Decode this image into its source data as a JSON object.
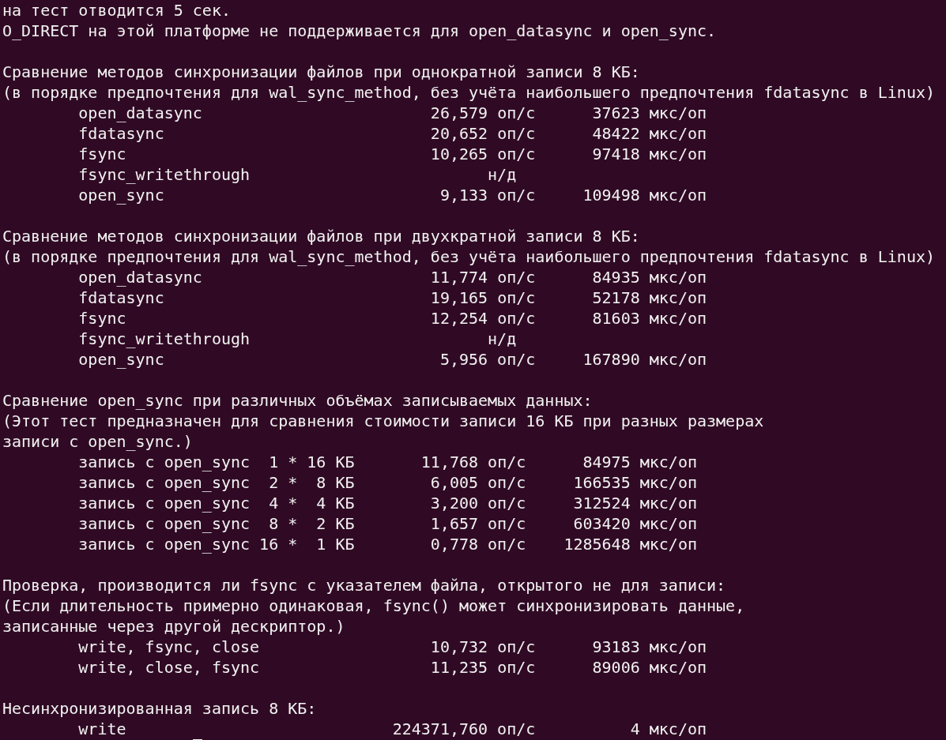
{
  "header_lines": [
    "на тест отводится 5 сек.",
    "O_DIRECT на этой платформе не поддерживается для open_datasync и open_sync."
  ],
  "sections": [
    {
      "kind": "sync",
      "title": "Сравнение методов синхронизации файлов при однократной записи 8 КБ:",
      "note_lines": [
        "(в порядке предпочтения для wal_sync_method, без учёта наибольшего предпочтения fdatasync в Linux)"
      ],
      "rows": [
        {
          "kind": "value",
          "name": "open_datasync",
          "rate": "26,579 оп/с",
          "latency": "37623 мкс/оп"
        },
        {
          "kind": "value",
          "name": "fdatasync",
          "rate": "20,652 оп/с",
          "latency": "48422 мкс/оп"
        },
        {
          "kind": "value",
          "name": "fsync",
          "rate": "10,265 оп/с",
          "latency": "97418 мкс/оп"
        },
        {
          "kind": "na",
          "name": "fsync_writethrough",
          "rate": "н/д"
        },
        {
          "kind": "value",
          "name": "open_sync",
          "rate": "9,133 оп/с",
          "latency": "109498 мкс/оп"
        }
      ]
    },
    {
      "kind": "sync",
      "title": "Сравнение методов синхронизации файлов при двухкратной записи 8 КБ:",
      "note_lines": [
        "(в порядке предпочтения для wal_sync_method, без учёта наибольшего предпочтения fdatasync в Linux)"
      ],
      "rows": [
        {
          "kind": "value",
          "name": "open_datasync",
          "rate": "11,774 оп/с",
          "latency": "84935 мкс/оп"
        },
        {
          "kind": "value",
          "name": "fdatasync",
          "rate": "19,165 оп/с",
          "latency": "52178 мкс/оп"
        },
        {
          "kind": "value",
          "name": "fsync",
          "rate": "12,254 оп/с",
          "latency": "81603 мкс/оп"
        },
        {
          "kind": "na",
          "name": "fsync_writethrough",
          "rate": "н/д"
        },
        {
          "kind": "value",
          "name": "open_sync",
          "rate": "5,956 оп/с",
          "latency": "167890 мкс/оп"
        }
      ]
    },
    {
      "kind": "size",
      "title": "Сравнение open_sync при различных объёмах записываемых данных:",
      "note_lines": [
        "(Этот тест предназначен для сравнения стоимости записи 16 КБ при разных размерах",
        "записи с open_sync.)"
      ],
      "rows": [
        {
          "kind": "value",
          "name": "запись с open_sync  1 * 16 КБ",
          "rate": "11,768 оп/с",
          "latency": "84975 мкс/оп"
        },
        {
          "kind": "value",
          "name": "запись с open_sync  2 *  8 КБ",
          "rate": "6,005 оп/с",
          "latency": "166535 мкс/оп"
        },
        {
          "kind": "value",
          "name": "запись с open_sync  4 *  4 КБ",
          "rate": "3,200 оп/с",
          "latency": "312524 мкс/оп"
        },
        {
          "kind": "value",
          "name": "запись с open_sync  8 *  2 КБ",
          "rate": "1,657 оп/с",
          "latency": "603420 мкс/оп"
        },
        {
          "kind": "value",
          "name": "запись с open_sync 16 *  1 КБ",
          "rate": "0,778 оп/с",
          "latency": "1285648 мкс/оп"
        }
      ]
    },
    {
      "kind": "sync",
      "title": "Проверка, производится ли fsync с указателем файла, открытого не для записи:",
      "note_lines": [
        "(Если длительность примерно одинаковая, fsync() может синхронизировать данные,",
        "записанные через другой дескриптор.)"
      ],
      "rows": [
        {
          "kind": "value",
          "name": "write, fsync, close",
          "rate": "10,732 оп/с",
          "latency": "93183 мкс/оп"
        },
        {
          "kind": "value",
          "name": "write, close, fsync",
          "rate": "11,235 оп/с",
          "latency": "89006 мкс/оп"
        }
      ]
    },
    {
      "kind": "sync",
      "title": "Несинхронизированная запись 8 КБ:",
      "rows": [
        {
          "kind": "value",
          "name": "write",
          "rate": "224371,760 оп/с",
          "latency": "4 мкс/оп"
        }
      ]
    }
  ]
}
